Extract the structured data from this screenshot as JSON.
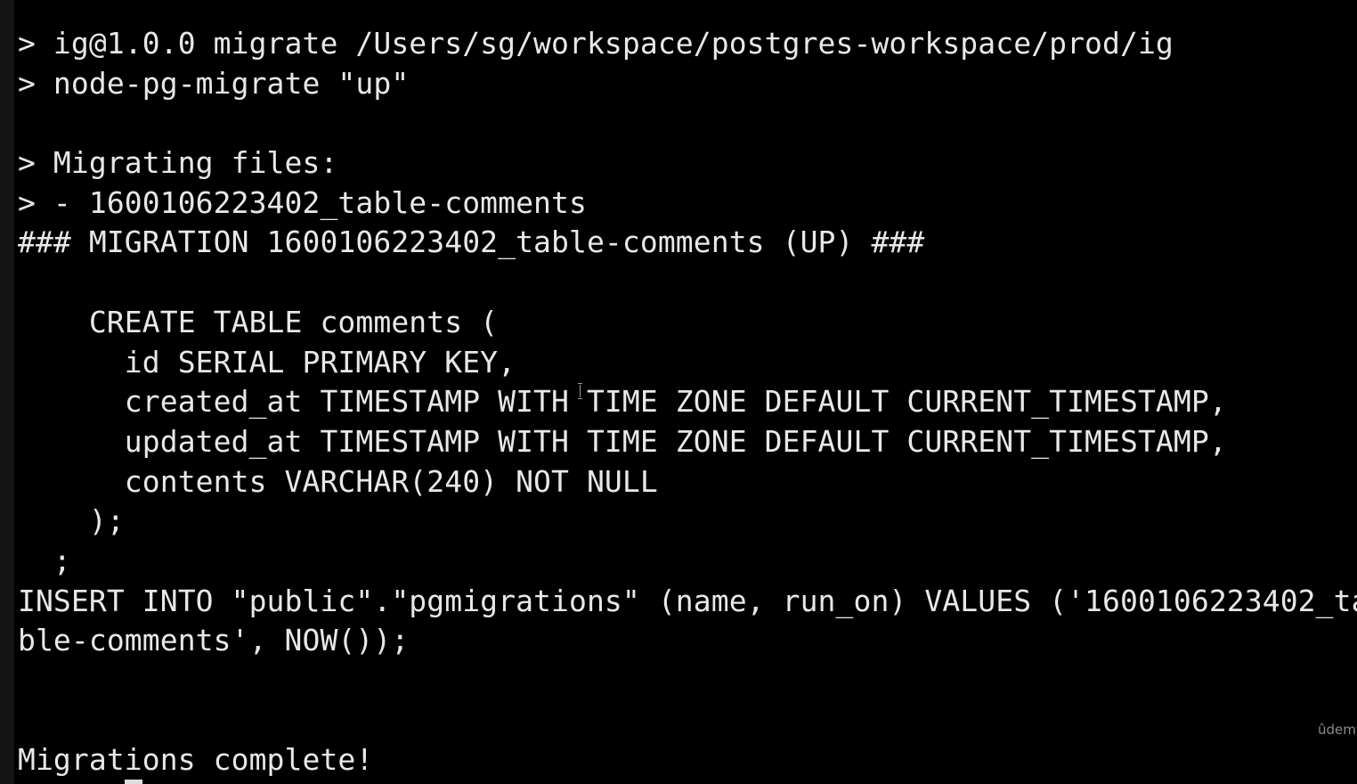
{
  "terminal": {
    "lines": [
      "> ig@1.0.0 migrate /Users/sg/workspace/postgres-workspace/prod/ig",
      "> node-pg-migrate \"up\"",
      "",
      "> Migrating files:",
      "> - 1600106223402_table-comments",
      "### MIGRATION 1600106223402_table-comments (UP) ###",
      "",
      "    CREATE TABLE comments (",
      "      id SERIAL PRIMARY KEY,",
      "      created_at TIMESTAMP WITH TIME ZONE DEFAULT CURRENT_TIMESTAMP,",
      "      updated_at TIMESTAMP WITH TIME ZONE DEFAULT CURRENT_TIMESTAMP,",
      "      contents VARCHAR(240) NOT NULL",
      "    );",
      "  ;",
      "INSERT INTO \"public\".\"pgmigrations\" (name, run_on) VALUES ('1600106223402_ta",
      "ble-comments', NOW());",
      "",
      "",
      "Migrations complete!"
    ]
  },
  "watermark": {
    "text": "ûdemy"
  },
  "colors": {
    "background": "#000000",
    "foreground": "#e8e8e8"
  }
}
